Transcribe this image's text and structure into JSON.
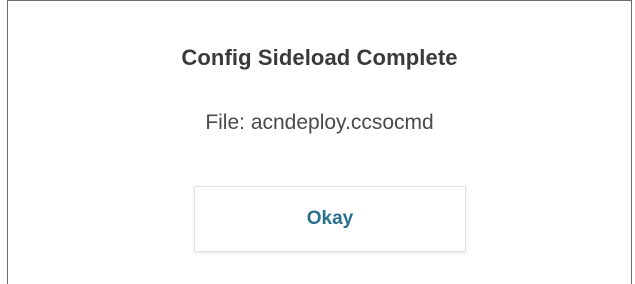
{
  "dialog": {
    "title": "Config Sideload Complete",
    "file_line": "File: acndeploy.ccsocmd",
    "okay_label": "Okay"
  },
  "colors": {
    "border": "#6b6b6b",
    "title_text": "#3a3a3a",
    "body_text": "#4a4a4a",
    "button_text": "#2a6f8e",
    "button_border": "#e3e3e3"
  }
}
